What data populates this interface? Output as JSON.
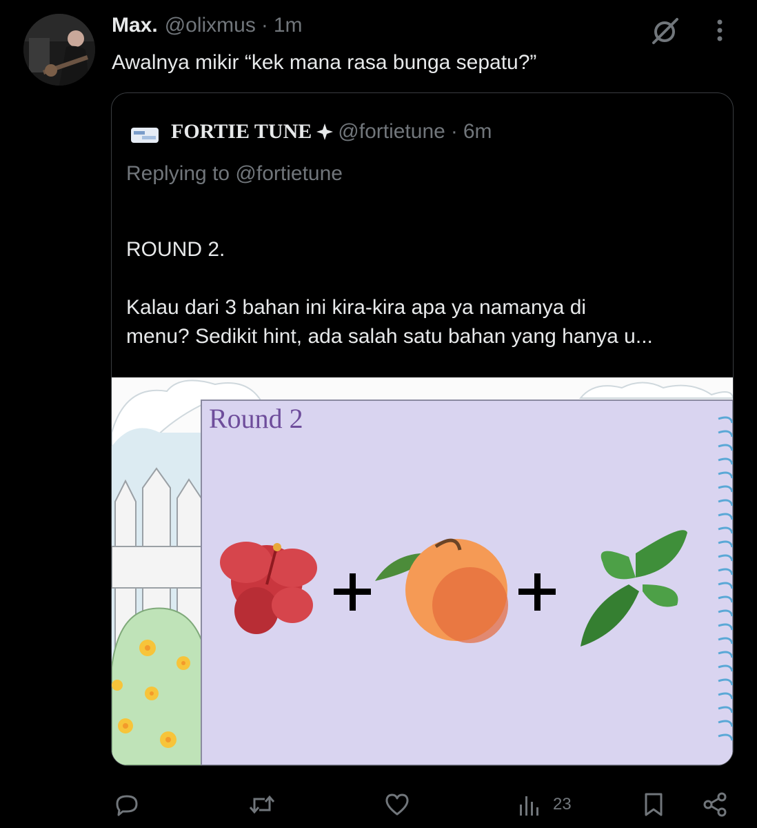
{
  "tweet": {
    "author": {
      "name": "Max.",
      "handle": "@olixmus",
      "time": "1m",
      "avatar_icon": "avatar-photo"
    },
    "separator": "·",
    "text": "Awalnya mikir “kek mana rasa bunga sepatu?”",
    "grok_icon": "grok-icon",
    "more_icon": "more-icon"
  },
  "quote": {
    "author": {
      "name": "FORTIE TUNE",
      "handle": "@fortietune",
      "time": "6m",
      "star_icon": "sparkle-icon"
    },
    "separator": "·",
    "replying": "Replying to @fortietune",
    "text_line1": "ROUND 2.",
    "text_line3": "Kalau dari 3 bahan ini kira-kira apa ya namanya di",
    "text_line4": "menu? Sedikit hint, ada salah satu bahan yang hanya u...",
    "image": {
      "round_label": "Round 2",
      "ingredients": [
        "hibiscus-flower",
        "peach",
        "mint-leaves"
      ],
      "operators": [
        "+",
        "+"
      ],
      "colors": {
        "card": "#d9d4f0",
        "fence": "#f4f4f4",
        "bush": "#bfe3b8",
        "sky": "#dcebf2"
      }
    }
  },
  "actions": {
    "reply_icon": "reply-icon",
    "retweet_icon": "retweet-icon",
    "like_icon": "like-icon",
    "views_icon": "views-icon",
    "views_count": "23",
    "bookmark_icon": "bookmark-icon",
    "share_icon": "share-icon"
  }
}
